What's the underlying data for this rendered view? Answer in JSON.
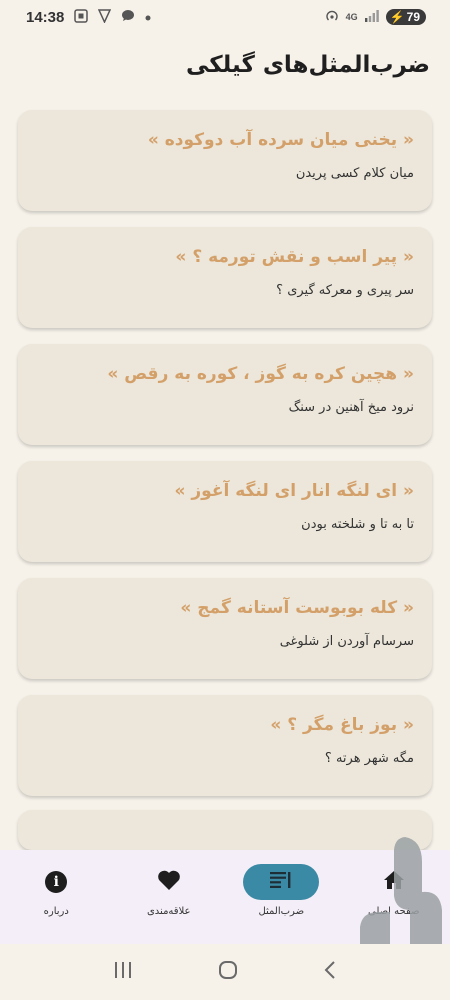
{
  "status_bar": {
    "time": "14:38",
    "network": "4G",
    "battery": "79"
  },
  "header": {
    "title": "ضرب‌المثل‌های گیلکی"
  },
  "proverbs": [
    {
      "title": "« یخنی میان سرده آب دوکوده »",
      "meaning": "میان کلام کسی پریدن"
    },
    {
      "title": "« پیر اسب و نقش تورمه ؟ »",
      "meaning": "سر پیری و معرکه گیری ؟"
    },
    {
      "title": "« هچین کره به گوز ، کوره به رقص »",
      "meaning": "نرود میخ آهنین در سنگ"
    },
    {
      "title": "« ای لنگه انار ای لنگه آغوز »",
      "meaning": "تا به تا و شلخته بودن"
    },
    {
      "title": "« کله بوبوست آستانه گمج »",
      "meaning": "سرسام آوردن از شلوغی"
    },
    {
      "title": "« بوز باغ مگر ؟ »",
      "meaning": "مگه شهر هرته ؟"
    }
  ],
  "bottom_nav": {
    "items": [
      {
        "label": "درباره",
        "icon": "info-icon"
      },
      {
        "label": "علاقه‌مندی",
        "icon": "heart-icon"
      },
      {
        "label": "ضرب‌المثل",
        "icon": "list-icon",
        "active": true
      },
      {
        "label": "صفحه اصلی",
        "icon": "home-icon"
      }
    ]
  },
  "colors": {
    "background": "#f6f2ea",
    "card": "#ece7da",
    "accent_text": "#d4a06a",
    "active_pill": "#3b8aa5",
    "nav_bg": "#f3eef7"
  }
}
